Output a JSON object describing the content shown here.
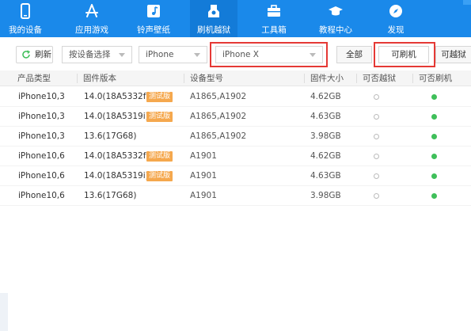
{
  "nav": {
    "items": [
      {
        "label": "我的设备",
        "icon": "phone-icon"
      },
      {
        "label": "应用游戏",
        "icon": "app-store-icon"
      },
      {
        "label": "铃声壁纸",
        "icon": "music-icon"
      },
      {
        "label": "刷机越狱",
        "icon": "flash-icon",
        "active": true
      },
      {
        "label": "工具箱",
        "icon": "toolbox-icon"
      },
      {
        "label": "教程中心",
        "icon": "graduation-cap-icon"
      },
      {
        "label": "发现",
        "icon": "compass-icon"
      }
    ]
  },
  "toolbar": {
    "refresh_label": "刷新",
    "device_select": "按设备选择",
    "model_select": "iPhone",
    "submodel_select": "iPhone X",
    "filter_all": "全部",
    "filter_flashable": "可刷机",
    "filter_jailbreak": "可越狱"
  },
  "table": {
    "headers": [
      "产品类型",
      "固件版本",
      "设备型号",
      "固件大小",
      "可否越狱",
      "可否刷机"
    ],
    "badge_label": "测试版",
    "rows": [
      {
        "type": "iPhone10,3",
        "firmware": "14.0(18A5332f)",
        "beta": true,
        "model": "A1865,A1902",
        "size": "4.62GB",
        "jailbreak": false,
        "flash": true
      },
      {
        "type": "iPhone10,3",
        "firmware": "14.0(18A5319i)",
        "beta": true,
        "model": "A1865,A1902",
        "size": "4.63GB",
        "jailbreak": false,
        "flash": true
      },
      {
        "type": "iPhone10,3",
        "firmware": "13.6(17G68)",
        "beta": false,
        "model": "A1865,A1902",
        "size": "3.98GB",
        "jailbreak": false,
        "flash": true
      },
      {
        "type": "iPhone10,6",
        "firmware": "14.0(18A5332f)",
        "beta": true,
        "model": "A1901",
        "size": "4.62GB",
        "jailbreak": false,
        "flash": true
      },
      {
        "type": "iPhone10,6",
        "firmware": "14.0(18A5319i)",
        "beta": true,
        "model": "A1901",
        "size": "4.63GB",
        "jailbreak": false,
        "flash": true
      },
      {
        "type": "iPhone10,6",
        "firmware": "13.6(17G68)",
        "beta": false,
        "model": "A1901",
        "size": "3.98GB",
        "jailbreak": false,
        "flash": true
      }
    ]
  },
  "colors": {
    "nav_bg": "#1a89ea",
    "badge": "#f5a84e",
    "flash_ok": "#3fbf5a",
    "highlight": "#e53935"
  }
}
